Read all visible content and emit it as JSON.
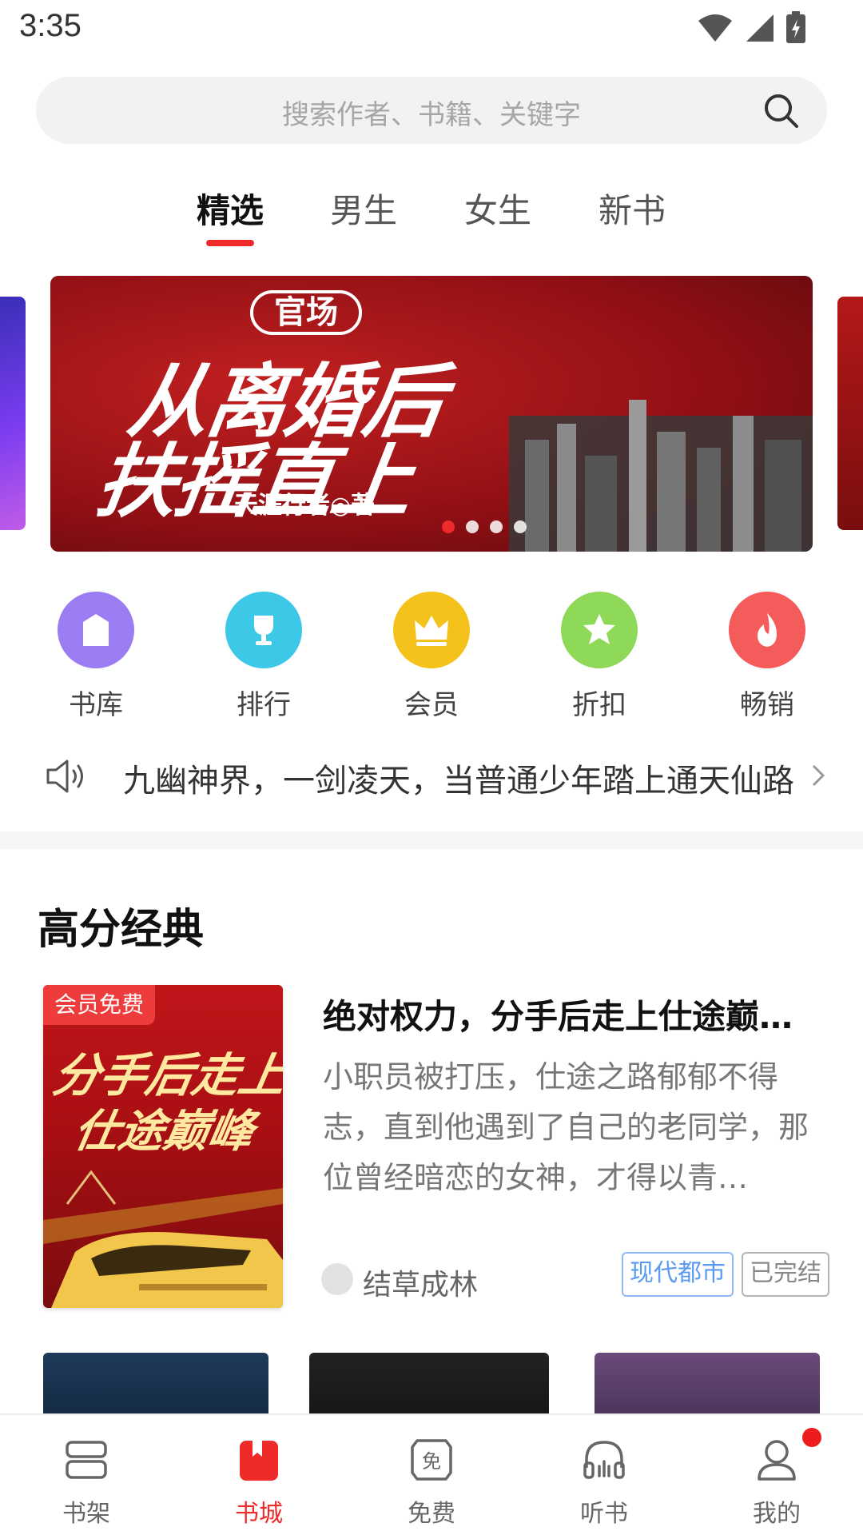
{
  "status_bar": {
    "time": "3:35"
  },
  "search": {
    "placeholder": "搜索作者、书籍、关键字"
  },
  "tabs": [
    {
      "label": "精选",
      "active": true
    },
    {
      "label": "男生",
      "active": false
    },
    {
      "label": "女生",
      "active": false
    },
    {
      "label": "新书",
      "active": false
    }
  ],
  "banner": {
    "tag": "官场",
    "title_line1": "从离婚后",
    "title_line2": "扶摇直上",
    "author": "天涯行者◎著",
    "page_count": 4,
    "active_page": 1
  },
  "quick_entries": [
    {
      "label": "书库",
      "icon": "library-icon",
      "color": "#9b7cf2"
    },
    {
      "label": "排行",
      "icon": "trophy-icon",
      "color": "#3cc8e6"
    },
    {
      "label": "会员",
      "icon": "crown-icon",
      "color": "#f5c21b"
    },
    {
      "label": "折扣",
      "icon": "star-icon",
      "color": "#8ed957"
    },
    {
      "label": "畅销",
      "icon": "flame-icon",
      "color": "#f45b5b"
    }
  ],
  "notice": {
    "text": "九幽神界，一剑凌天，当普通少年踏上通天仙路"
  },
  "section": {
    "title": "高分经典"
  },
  "featured_book": {
    "badge": "会员免费",
    "cover_line1": "分手后走上",
    "cover_line2": "仕途巅峰",
    "title": "绝对权力，分手后走上仕途巅…",
    "description": "小职员被打压，仕途之路郁郁不得志，直到他遇到了自己的老同学，那位曾经暗恋的女神，才得以青…",
    "author": "结草成林",
    "tags": [
      "现代都市",
      "已完结"
    ]
  },
  "bottom_nav": [
    {
      "label": "书架",
      "icon": "bookshelf-icon",
      "active": false
    },
    {
      "label": "书城",
      "icon": "bookstore-icon",
      "active": true
    },
    {
      "label": "免费",
      "icon": "free-icon",
      "active": false
    },
    {
      "label": "听书",
      "icon": "headphones-icon",
      "active": false
    },
    {
      "label": "我的",
      "icon": "profile-icon",
      "active": false,
      "notification_dot": true
    }
  ],
  "colors": {
    "accent": "#ee2a2a",
    "tag_blue": "#5a9af0"
  }
}
